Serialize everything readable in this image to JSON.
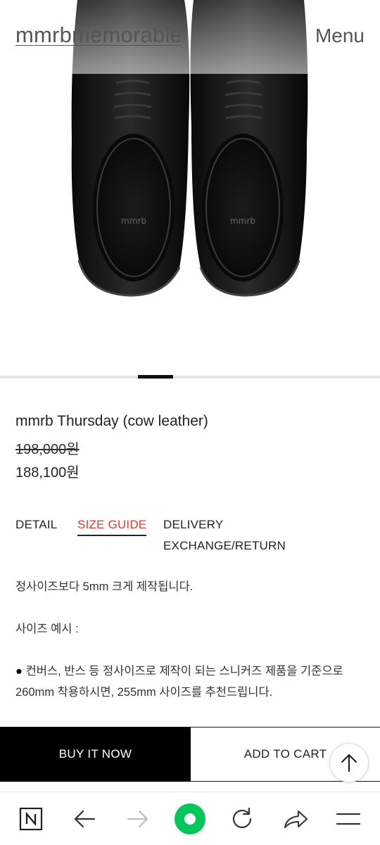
{
  "header": {
    "logo": "mmrbmemorable",
    "menu_label": "Menu"
  },
  "hero": {
    "image": "black-leather-shoes-top-view",
    "insole_brand": "mmrb"
  },
  "slider": {
    "active_index": 1,
    "total": 3
  },
  "product": {
    "name": "mmrb Thursday (cow leather)",
    "original_price": "198,000원",
    "sale_price": "188,100원"
  },
  "tabs": [
    {
      "label": "DETAIL",
      "active": false
    },
    {
      "label": "SIZE GUIDE",
      "active": true
    },
    {
      "label": "DELIVERY",
      "active": false
    },
    {
      "label": "EXCHANGE/RETURN",
      "active": false
    }
  ],
  "size_guide": {
    "line1": "정사이즈보다 5mm 크게 제작됩니다.",
    "line2": "사이즈 예시 :",
    "line3_bullet": "●",
    "line3": "컨버스, 반스 등 정사이즈로 제작이 되는 스니커즈 제품을 기준으로 260mm 착용하시면, 255mm 사이즈를 추천드립니다."
  },
  "actions": {
    "buy_now": "BUY IT NOW",
    "add_to_cart": "ADD TO CART"
  },
  "browser_nav": {
    "icons": [
      "naver-n-icon",
      "back-arrow-icon",
      "forward-arrow-icon",
      "green-dot-icon",
      "refresh-icon",
      "share-icon",
      "hamburger-menu-icon"
    ],
    "accent": "#03c75a"
  }
}
